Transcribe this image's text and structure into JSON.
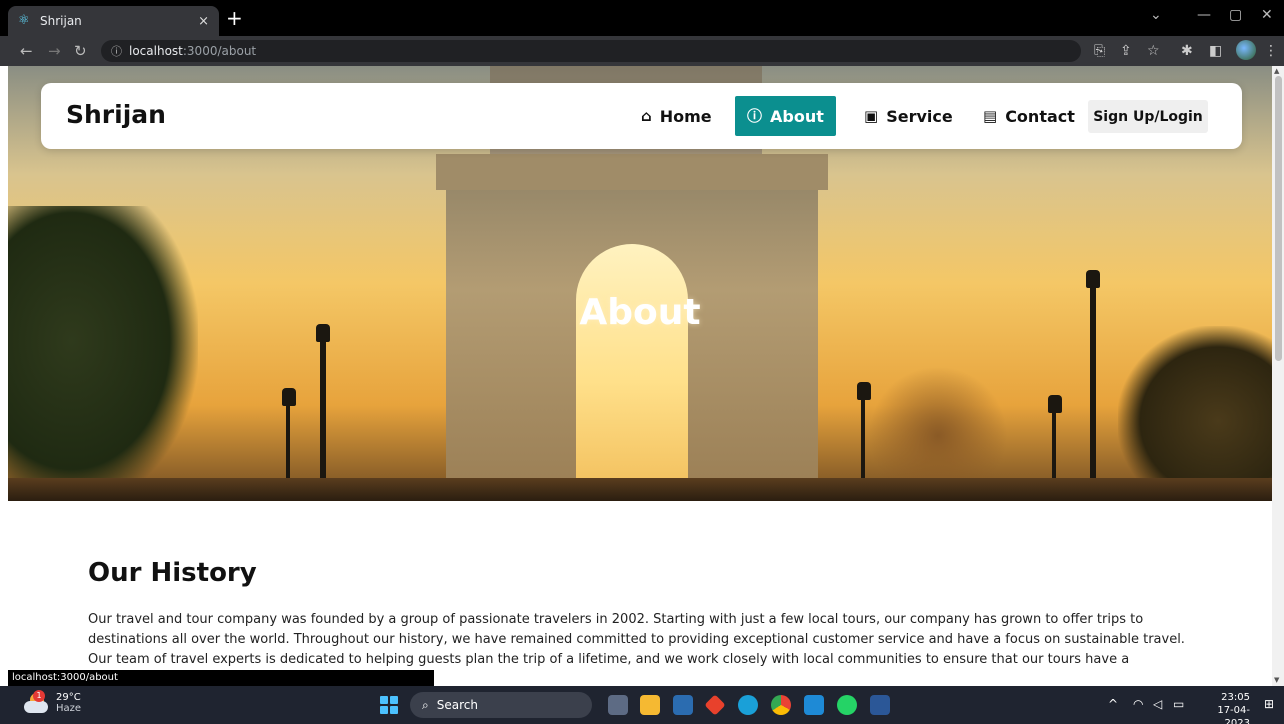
{
  "browser": {
    "tab_title": "Shrijan",
    "tab_close": "×",
    "new_tab": "+",
    "url_host": "localhost",
    "url_path": ":3000/about",
    "status_link": "localhost:3000/about"
  },
  "navbar": {
    "brand": "Shrijan",
    "links": [
      {
        "label": "Home",
        "icon": "home-icon"
      },
      {
        "label": "About",
        "icon": "info-icon"
      },
      {
        "label": "Service",
        "icon": "briefcase-icon"
      },
      {
        "label": "Contact",
        "icon": "contact-book-icon"
      }
    ],
    "active": "About",
    "signup_label": "Sign Up/Login",
    "accent_color": "#0b8f8f"
  },
  "hero": {
    "title": "About"
  },
  "history": {
    "heading": "Our History",
    "body": "Our travel and tour company was founded by a group of passionate travelers in 2002. Starting with just a few local tours, our company has grown to offer trips to destinations all over the world. Throughout our history, we have remained committed to providing exceptional customer service and have a focus on sustainable travel. Our team of travel experts is dedicated to helping guests plan the trip of a lifetime, and we work closely with local communities to ensure that our tours have a"
  },
  "taskbar": {
    "weather_temp": "29°C",
    "weather_desc": "Haze",
    "weather_badge": "1",
    "search_label": "Search",
    "time": "23:05",
    "date": "17-04-2023"
  }
}
